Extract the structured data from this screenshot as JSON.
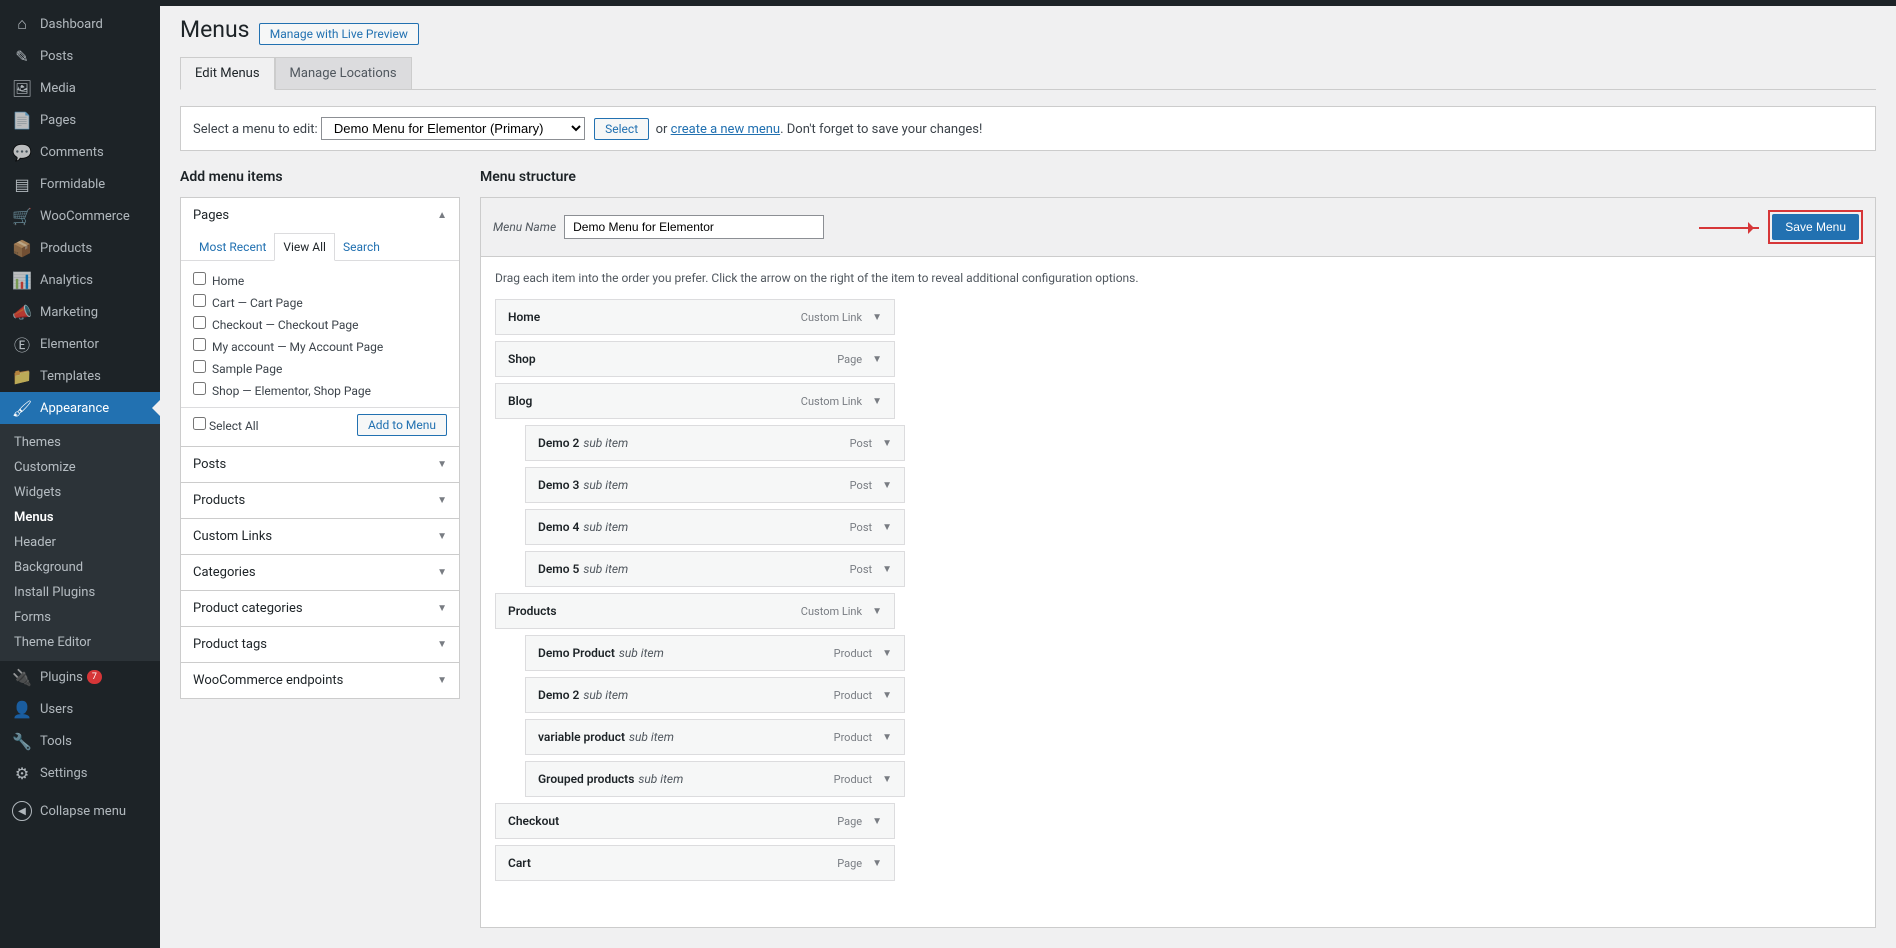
{
  "sidebar": {
    "items": [
      {
        "label": "Dashboard",
        "icon": "⌂"
      },
      {
        "label": "Posts",
        "icon": "✎"
      },
      {
        "label": "Media",
        "icon": "🖼"
      },
      {
        "label": "Pages",
        "icon": "📄"
      },
      {
        "label": "Comments",
        "icon": "💬"
      },
      {
        "label": "Formidable",
        "icon": "▤"
      },
      {
        "label": "WooCommerce",
        "icon": "🛒"
      },
      {
        "label": "Products",
        "icon": "📦"
      },
      {
        "label": "Analytics",
        "icon": "📊"
      },
      {
        "label": "Marketing",
        "icon": "📣"
      },
      {
        "label": "Elementor",
        "icon": "Ⓔ"
      },
      {
        "label": "Templates",
        "icon": "📁"
      },
      {
        "label": "Appearance",
        "icon": "🖌",
        "current": true
      },
      {
        "label": "Plugins",
        "icon": "🔌",
        "badge": "7"
      },
      {
        "label": "Users",
        "icon": "👤"
      },
      {
        "label": "Tools",
        "icon": "🔧"
      },
      {
        "label": "Settings",
        "icon": "⚙"
      }
    ],
    "appearance_submenu": [
      {
        "label": "Themes"
      },
      {
        "label": "Customize"
      },
      {
        "label": "Widgets"
      },
      {
        "label": "Menus",
        "current": true
      },
      {
        "label": "Header"
      },
      {
        "label": "Background"
      },
      {
        "label": "Install Plugins"
      },
      {
        "label": "Forms"
      },
      {
        "label": "Theme Editor"
      }
    ],
    "collapse": "Collapse menu"
  },
  "header": {
    "title": "Menus",
    "live_preview": "Manage with Live Preview",
    "tabs": [
      {
        "label": "Edit Menus",
        "active": true
      },
      {
        "label": "Manage Locations"
      }
    ]
  },
  "select_bar": {
    "label": "Select a menu to edit:",
    "selected": "Demo Menu for Elementor (Primary)",
    "select_btn": "Select",
    "or": "or",
    "create_link": "create a new menu",
    "suffix": ". Don't forget to save your changes!"
  },
  "add_items": {
    "title": "Add menu items",
    "pages": {
      "label": "Pages",
      "tabs": [
        "Most Recent",
        "View All",
        "Search"
      ],
      "active_tab": "View All",
      "items": [
        "Home",
        "Cart — Cart Page",
        "Checkout — Checkout Page",
        "My account — My Account Page",
        "Sample Page",
        "Shop — Elementor, Shop Page"
      ],
      "select_all": "Select All",
      "add_btn": "Add to Menu"
    },
    "accordions": [
      "Posts",
      "Products",
      "Custom Links",
      "Categories",
      "Product categories",
      "Product tags",
      "WooCommerce endpoints"
    ]
  },
  "menu_structure": {
    "title": "Menu structure",
    "menu_name_label": "Menu Name",
    "menu_name_value": "Demo Menu for Elementor",
    "save_btn": "Save Menu",
    "instruction": "Drag each item into the order you prefer. Click the arrow on the right of the item to reveal additional configuration options.",
    "items": [
      {
        "title": "Home",
        "type": "Custom Link",
        "sub": false
      },
      {
        "title": "Shop",
        "type": "Page",
        "sub": false
      },
      {
        "title": "Blog",
        "type": "Custom Link",
        "sub": false
      },
      {
        "title": "Demo 2",
        "subtext": "sub item",
        "type": "Post",
        "sub": true
      },
      {
        "title": "Demo 3",
        "subtext": "sub item",
        "type": "Post",
        "sub": true
      },
      {
        "title": "Demo 4",
        "subtext": "sub item",
        "type": "Post",
        "sub": true
      },
      {
        "title": "Demo 5",
        "subtext": "sub item",
        "type": "Post",
        "sub": true
      },
      {
        "title": "Products",
        "type": "Custom Link",
        "sub": false
      },
      {
        "title": "Demo Product",
        "subtext": "sub item",
        "type": "Product",
        "sub": true
      },
      {
        "title": "Demo 2",
        "subtext": "sub item",
        "type": "Product",
        "sub": true
      },
      {
        "title": "variable product",
        "subtext": "sub item",
        "type": "Product",
        "sub": true
      },
      {
        "title": "Grouped products",
        "subtext": "sub item",
        "type": "Product",
        "sub": true
      },
      {
        "title": "Checkout",
        "type": "Page",
        "sub": false
      },
      {
        "title": "Cart",
        "type": "Page",
        "sub": false
      }
    ]
  }
}
